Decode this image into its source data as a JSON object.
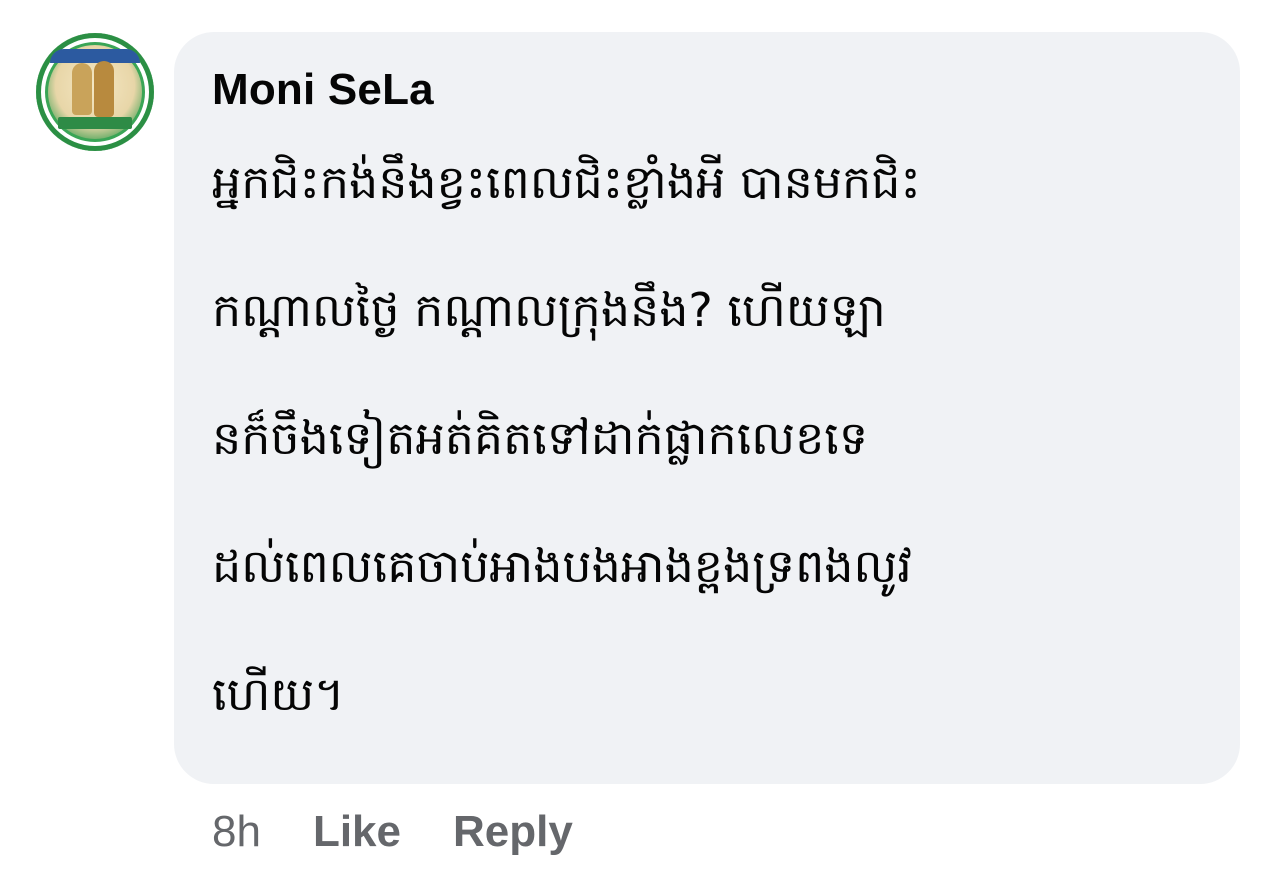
{
  "comment": {
    "author": "Moni SeLa",
    "text_lines": [
      "អ្នកជិះកង់នឹងខ្វះពេលជិះខ្លាំងអី បានមកជិះ",
      "កណ្ដាលថ្ងៃ កណ្ដាលក្រុងនឹង? ហើយឡា",
      "នក៏ចឹងទៀតអត់គិតទៅដាក់ផ្លាកលេខទេ",
      "ដល់ពេលគេចាប់អាងបងអាងខ្ពងទ្រពងលូវ",
      "ហើយ។"
    ],
    "timestamp": "8h",
    "like_label": "Like",
    "reply_label": "Reply"
  },
  "colors": {
    "bubble_bg": "#f0f2f5",
    "text": "#050505",
    "meta": "#65676b"
  },
  "icons": {
    "avatar": "profile-photo"
  }
}
